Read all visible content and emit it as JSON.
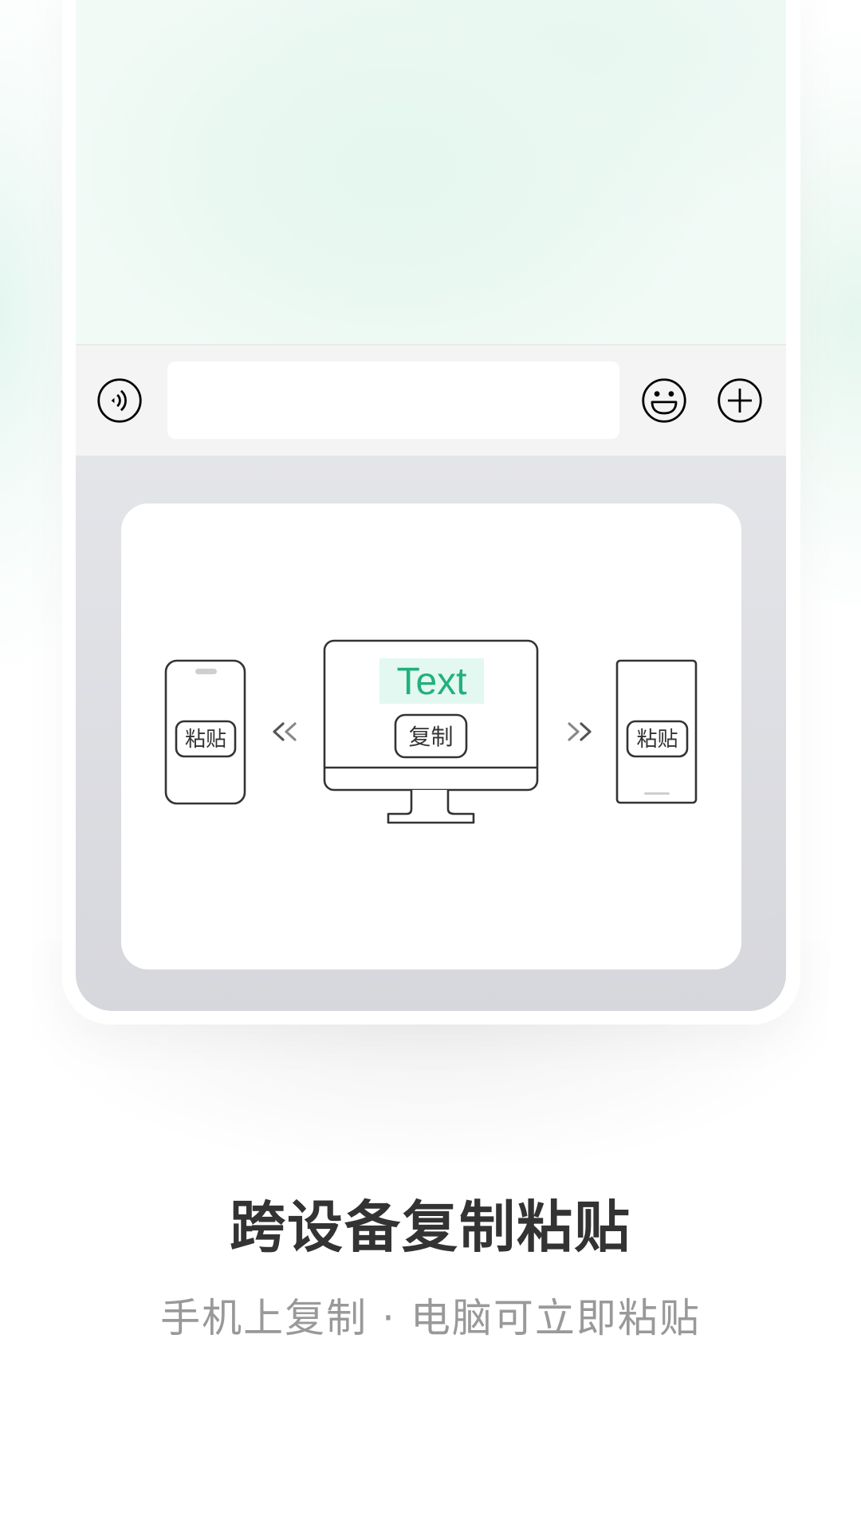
{
  "chat_input": {
    "value": "",
    "placeholder": ""
  },
  "icons": {
    "voice": "voice-icon",
    "emoji": "emoji-icon",
    "plus": "plus-icon"
  },
  "illustration": {
    "left_phone_button": "粘贴",
    "monitor_text": "Text",
    "monitor_button": "复制",
    "right_phone_button": "粘贴",
    "left_arrow": "«",
    "right_arrow": "»"
  },
  "colors": {
    "accent_green": "#22b07d",
    "highlight_mint": "#e3f8f0",
    "stroke": "#333333",
    "title": "#333333",
    "subtitle": "#999999"
  },
  "headline": {
    "title": "跨设备复制粘贴",
    "subtitle": "手机上复制 · 电脑可立即粘贴"
  }
}
